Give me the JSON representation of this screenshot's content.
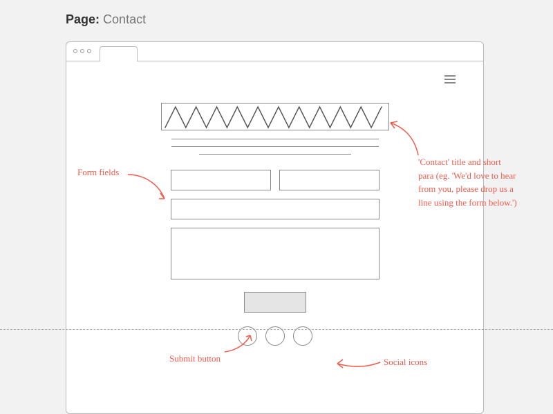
{
  "page_label_prefix": "Page:",
  "page_label_name": "Contact",
  "annotations": {
    "form_fields": "Form fields",
    "title_para": "'Contact' title and short para (eg. 'We'd love to hear from you, please drop us a line using the form below.')",
    "submit": "Submit button",
    "social": "Social icons"
  }
}
